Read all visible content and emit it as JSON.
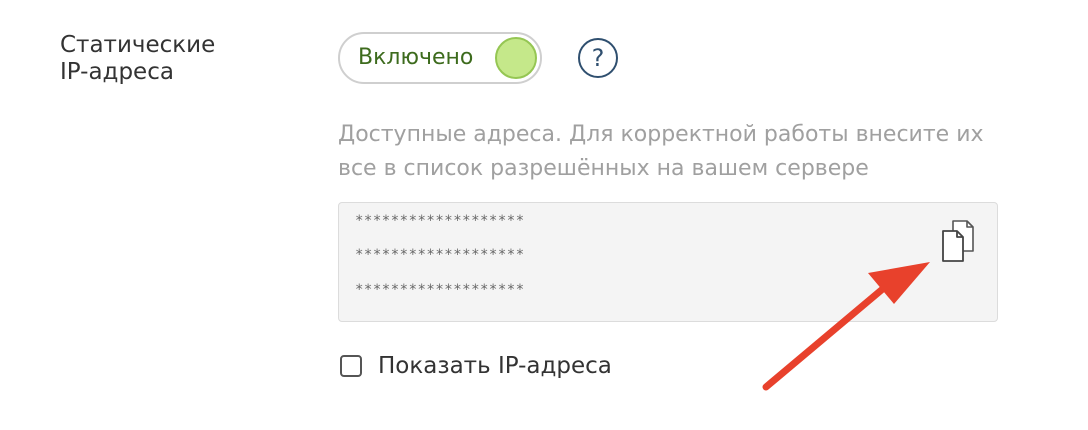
{
  "setting": {
    "label_line1": "Статические",
    "label_line2": "IP-адреса"
  },
  "toggle": {
    "label": "Включено",
    "state": "on",
    "accent_color": "#c5e88a"
  },
  "help": {
    "glyph": "?"
  },
  "hint": {
    "text": "Доступные адреса. Для корректной работы внесите их все в список разрешённых на вашем сервере"
  },
  "ip_list": {
    "addresses": [
      "*******************",
      "*******************",
      "*******************"
    ],
    "copy_icon": "copy-icon"
  },
  "show_ips": {
    "label": "Показать IP-адреса",
    "checked": false
  },
  "annotation": {
    "arrow_color": "#e8412c"
  }
}
